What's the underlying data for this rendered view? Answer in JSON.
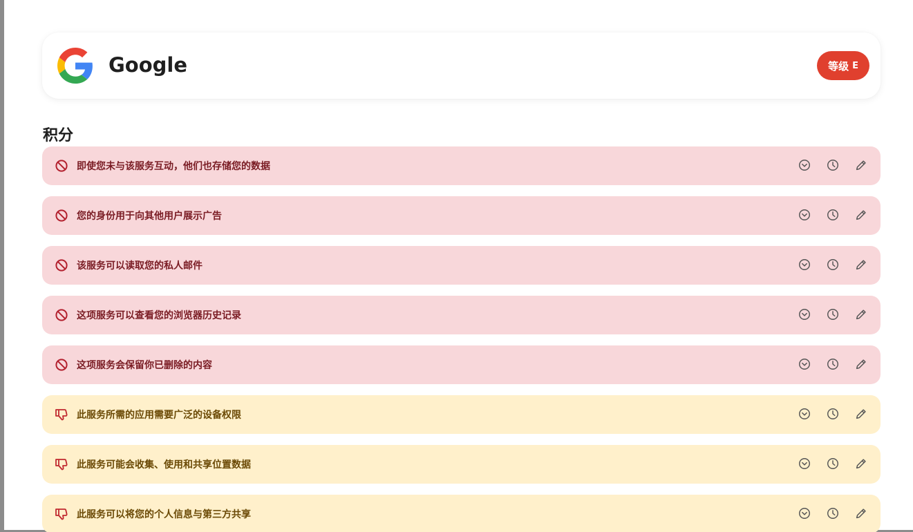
{
  "service": {
    "name": "Google",
    "logo_icon": "google-logo",
    "grade_label": "等级",
    "grade_value": "E",
    "grade_color": "#e0402e"
  },
  "section": {
    "title": "积分"
  },
  "colors": {
    "blocker_bg": "#f8d7da",
    "blocker_text": "#7a1c24",
    "bad_bg": "#fff0cb",
    "bad_text": "#6b4a06"
  },
  "points": [
    {
      "type": "blocker",
      "icon": "ban-icon",
      "text": "即使您未与该服务互动，他们也存储您的数据"
    },
    {
      "type": "blocker",
      "icon": "ban-icon",
      "text": "您的身份用于向其他用户展示广告"
    },
    {
      "type": "blocker",
      "icon": "ban-icon",
      "text": "该服务可以读取您的私人邮件"
    },
    {
      "type": "blocker",
      "icon": "ban-icon",
      "text": "这项服务可以查看您的浏览器历史记录"
    },
    {
      "type": "blocker",
      "icon": "ban-icon",
      "text": "这项服务会保留你已删除的内容"
    },
    {
      "type": "bad",
      "icon": "thumbs-down-icon",
      "text": "此服务所需的应用需要广泛的设备权限"
    },
    {
      "type": "bad",
      "icon": "thumbs-down-icon",
      "text": "此服务可能会收集、使用和共享位置数据"
    },
    {
      "type": "bad",
      "icon": "thumbs-down-icon",
      "text": "此服务可以将您的个人信息与第三方共享"
    }
  ],
  "point_actions": [
    "expand-icon",
    "history-icon",
    "edit-icon"
  ]
}
